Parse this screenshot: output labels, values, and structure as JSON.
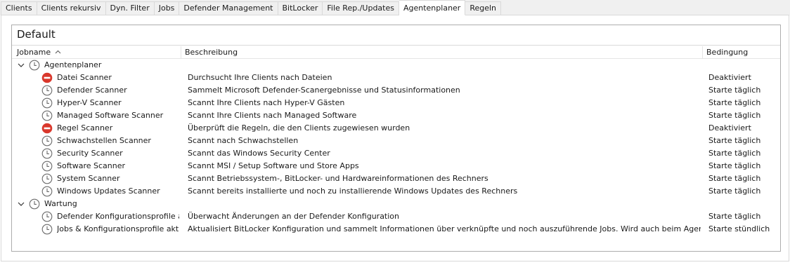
{
  "tabs": [
    {
      "label": "Clients",
      "active": false
    },
    {
      "label": "Clients rekursiv",
      "active": false
    },
    {
      "label": "Dyn. Filter",
      "active": false
    },
    {
      "label": "Jobs",
      "active": false
    },
    {
      "label": "Defender Management",
      "active": false
    },
    {
      "label": "BitLocker",
      "active": false
    },
    {
      "label": "File Rep./Updates",
      "active": false
    },
    {
      "label": "Agentenplaner",
      "active": true
    },
    {
      "label": "Regeln",
      "active": false
    }
  ],
  "group": {
    "title": "Default"
  },
  "columns": {
    "jobname": "Jobname",
    "beschreibung": "Beschreibung",
    "bedingung": "Bedingung"
  },
  "sort": {
    "column": "jobname",
    "direction": "ascending"
  },
  "categories": [
    {
      "name": "Agentenplaner",
      "expanded": true,
      "jobs": [
        {
          "name": "Datei Scanner",
          "description": "Durchsucht Ihre Clients nach Dateien",
          "condition": "Deaktiviert",
          "icon": "disabled-icon"
        },
        {
          "name": "Defender Scanner",
          "description": "Sammelt Microsoft Defender-Scanergebnisse und Statusinformationen",
          "condition": "Starte täglich",
          "icon": "clock-icon"
        },
        {
          "name": "Hyper-V Scanner",
          "description": "Scannt Ihre Clients nach Hyper-V Gästen",
          "condition": "Starte täglich",
          "icon": "clock-icon"
        },
        {
          "name": "Managed Software Scanner",
          "description": "Scannt Ihre Clients nach Managed Software",
          "condition": "Starte täglich",
          "icon": "clock-icon"
        },
        {
          "name": "Regel Scanner",
          "description": "Überprüft die Regeln, die den Clients zugewiesen wurden",
          "condition": "Deaktiviert",
          "icon": "disabled-icon"
        },
        {
          "name": "Schwachstellen Scanner",
          "description": "Scannt nach Schwachstellen",
          "condition": "Starte täglich",
          "icon": "clock-icon"
        },
        {
          "name": "Security Scanner",
          "description": "Scannt das Windows Security Center",
          "condition": "Starte täglich",
          "icon": "clock-icon"
        },
        {
          "name": "Software Scanner",
          "description": "Scannt MSI / Setup Software und Store Apps",
          "condition": "Starte täglich",
          "icon": "clock-icon"
        },
        {
          "name": "System Scanner",
          "description": "Scannt Betriebssystem-, BitLocker- und Hardwareinformationen des Rechners",
          "condition": "Starte täglich",
          "icon": "clock-icon"
        },
        {
          "name": "Windows Updates Scanner",
          "description": "Scannt bereits installierte und noch zu installierende Windows Updates des Rechners",
          "condition": "Starte täglich",
          "icon": "clock-icon"
        }
      ]
    },
    {
      "name": "Wartung",
      "expanded": true,
      "jobs": [
        {
          "name": "Defender Konfigurationsprofile a...",
          "description": "Überwacht Änderungen an der Defender Konfiguration",
          "condition": "Starte täglich",
          "icon": "clock-icon"
        },
        {
          "name": "Jobs & Konfigurationsprofile aktu...",
          "description": "Aktualisiert BitLocker Konfiguration und sammelt Informationen über verknüpfte und noch auszuführende Jobs. Wird auch beim Agent Start ausgeführt.",
          "condition": "Starte stündlich",
          "icon": "clock-icon"
        }
      ]
    }
  ],
  "colors": {
    "disabled": "#d9382c",
    "clock": "#6b6b6b",
    "border": "#adadad",
    "tab_border": "#d9d9d9"
  }
}
